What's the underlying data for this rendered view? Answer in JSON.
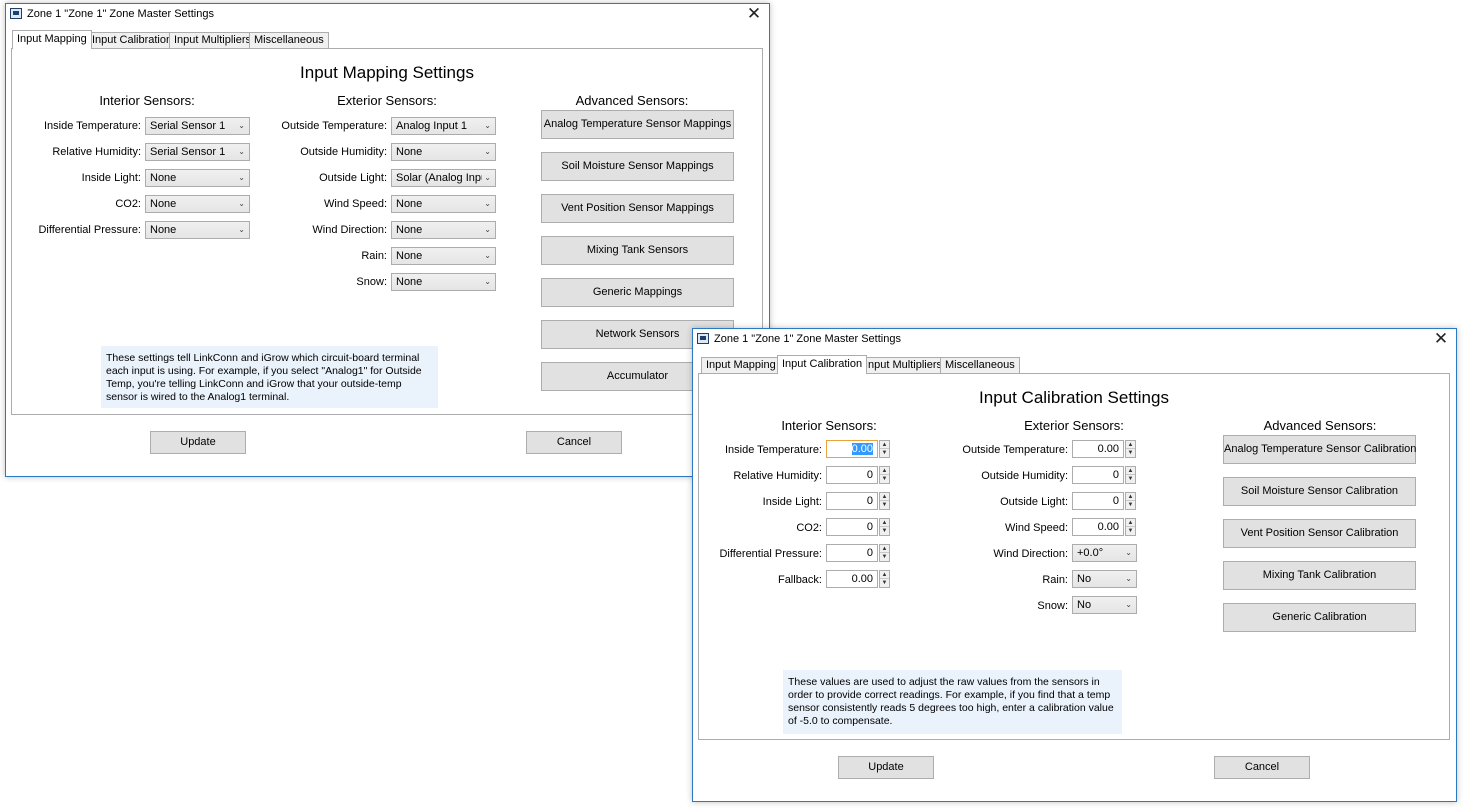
{
  "window1": {
    "title": "Zone 1 \"Zone 1\" Zone Master Settings",
    "tabs": [
      "Input Mapping",
      "Input Calibration",
      "Input Multipliers",
      "Miscellaneous"
    ],
    "active_tab": "Input Mapping",
    "heading": "Input Mapping Settings",
    "interior_heading": "Interior Sensors:",
    "exterior_heading": "Exterior Sensors:",
    "advanced_heading": "Advanced Sensors:",
    "interior": [
      {
        "label": "Inside Temperature:",
        "value": "Serial Sensor 1"
      },
      {
        "label": "Relative Humidity:",
        "value": "Serial Sensor 1"
      },
      {
        "label": "Inside Light:",
        "value": "None"
      },
      {
        "label": "CO2:",
        "value": "None"
      },
      {
        "label": "Differential Pressure:",
        "value": "None"
      }
    ],
    "exterior": [
      {
        "label": "Outside Temperature:",
        "value": "Analog Input 1"
      },
      {
        "label": "Outside Humidity:",
        "value": "None"
      },
      {
        "label": "Outside Light:",
        "value": "Solar (Analog Input"
      },
      {
        "label": "Wind Speed:",
        "value": "None"
      },
      {
        "label": "Wind Direction:",
        "value": "None"
      },
      {
        "label": "Rain:",
        "value": "None"
      },
      {
        "label": "Snow:",
        "value": "None"
      }
    ],
    "advanced_buttons": [
      "Analog Temperature Sensor Mappings",
      "Soil Moisture Sensor Mappings",
      "Vent Position Sensor Mappings",
      "Mixing Tank Sensors",
      "Generic Mappings",
      "Network Sensors",
      "Accumulator"
    ],
    "help_text": "These settings tell LinkConn and iGrow which circuit-board terminal each input is using. For example, if you select \"Analog1\" for Outside Temp, you're telling LinkConn and iGrow that your outside-temp sensor is wired to the Analog1 terminal.",
    "update_label": "Update",
    "cancel_label": "Cancel"
  },
  "window2": {
    "title": "Zone 1 \"Zone 1\" Zone Master Settings",
    "tabs": [
      "Input Mapping",
      "Input Calibration",
      "Input Multipliers",
      "Miscellaneous"
    ],
    "active_tab": "Input Calibration",
    "heading": "Input Calibration Settings",
    "interior_heading": "Interior Sensors:",
    "exterior_heading": "Exterior Sensors:",
    "advanced_heading": "Advanced Sensors:",
    "interior": [
      {
        "label": "Inside Temperature:",
        "value": "0.00"
      },
      {
        "label": "Relative Humidity:",
        "value": "0"
      },
      {
        "label": "Inside Light:",
        "value": "0"
      },
      {
        "label": "CO2:",
        "value": "0"
      },
      {
        "label": "Differential Pressure:",
        "value": "0"
      },
      {
        "label": "Fallback:",
        "value": "0.00"
      }
    ],
    "exterior": [
      {
        "label": "Outside Temperature:",
        "value": "0.00"
      },
      {
        "label": "Outside Humidity:",
        "value": "0"
      },
      {
        "label": "Outside Light:",
        "value": "0"
      },
      {
        "label": "Wind Speed:",
        "value": "0.00"
      },
      {
        "label": "Wind Direction:",
        "value": "+0.0°"
      },
      {
        "label": "Rain:",
        "value": "No"
      },
      {
        "label": "Snow:",
        "value": "No"
      }
    ],
    "advanced_buttons": [
      "Analog Temperature Sensor Calibration",
      "Soil Moisture Sensor Calibration",
      "Vent Position Sensor Calibration",
      "Mixing Tank Calibration",
      "Generic Calibration"
    ],
    "help_text": "These values are used to adjust the raw values from the sensors in order to provide correct readings. For example, if you find that a temp sensor consistently reads 5 degrees too high, enter a calibration value of -5.0 to compensate.",
    "update_label": "Update",
    "cancel_label": "Cancel"
  },
  "icons": {
    "close": "✕",
    "chevron": "⌄",
    "up": "▲",
    "down": "▼"
  }
}
